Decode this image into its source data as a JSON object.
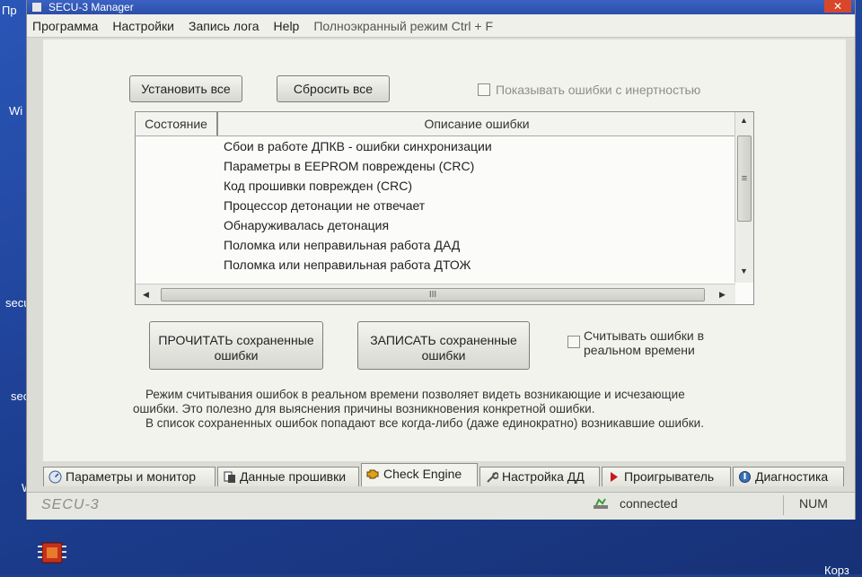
{
  "desktop": {
    "labels": [
      "Пр",
      "Wi",
      "secu",
      "secu",
      "Wi",
      "Корз"
    ]
  },
  "window": {
    "title": "SECU-3 Manager",
    "close_symbol": "✕"
  },
  "menu": [
    "Программа",
    "Настройки",
    "Запись лога",
    "Help"
  ],
  "menu_hint": "Полноэкранный режим Ctrl + F",
  "buttons": {
    "set_all": "Установить все",
    "reset_all": "Сбросить все",
    "read_saved": [
      "ПРОЧИТАТЬ сохраненные",
      "ошибки"
    ],
    "write_saved": [
      "ЗАПИСАТЬ сохраненные",
      "ошибки"
    ]
  },
  "checkboxes": {
    "inertia": "Показывать ошибки с инертностью",
    "realtime": [
      "Считывать ошибки в",
      "реальном времени"
    ]
  },
  "table": {
    "headers": {
      "state": "Состояние",
      "description": "Описание ошибки"
    },
    "rows": [
      "Сбои в работе ДПКВ - ошибки синхронизации",
      "Параметры в EEPROM повреждены (CRC)",
      "Код прошивки поврежден (CRC)",
      "Процессор детонации не отвечает",
      "Обнаруживалась детонация",
      "Поломка или неправильная работа ДАД",
      "Поломка или неправильная работа ДТОЖ"
    ],
    "scroll_grip": "≡",
    "hscroll_grip": "III"
  },
  "info": [
    "Режим считывания ошибок в реальном времени позволяет видеть возникающие и исчезающие",
    "ошибки. Это полезно для выяснения причины возникновения конкретной ошибки.",
    "В список сохраненных ошибок попадают все когда-либо (даже единократно) возникавшие ошибки."
  ],
  "tabs": [
    {
      "label": "Параметры и монитор",
      "icon": "gauge-icon"
    },
    {
      "label": "Данные прошивки",
      "icon": "firmware-icon"
    },
    {
      "label": "Check Engine",
      "icon": "engine-icon"
    },
    {
      "label": "Настройка ДД",
      "icon": "wrench-icon"
    },
    {
      "label": "Проигрыватель",
      "icon": "play-icon"
    },
    {
      "label": "Диагностика",
      "icon": "diagnostics-icon"
    }
  ],
  "active_tab": 2,
  "status": {
    "brand": "SECU-3",
    "connection": "connected",
    "num": "NUM"
  },
  "colors": {
    "play_icon": "#c8171d",
    "engine_icon": "#e0a017",
    "desktop_bg": "#1d3f8c"
  }
}
